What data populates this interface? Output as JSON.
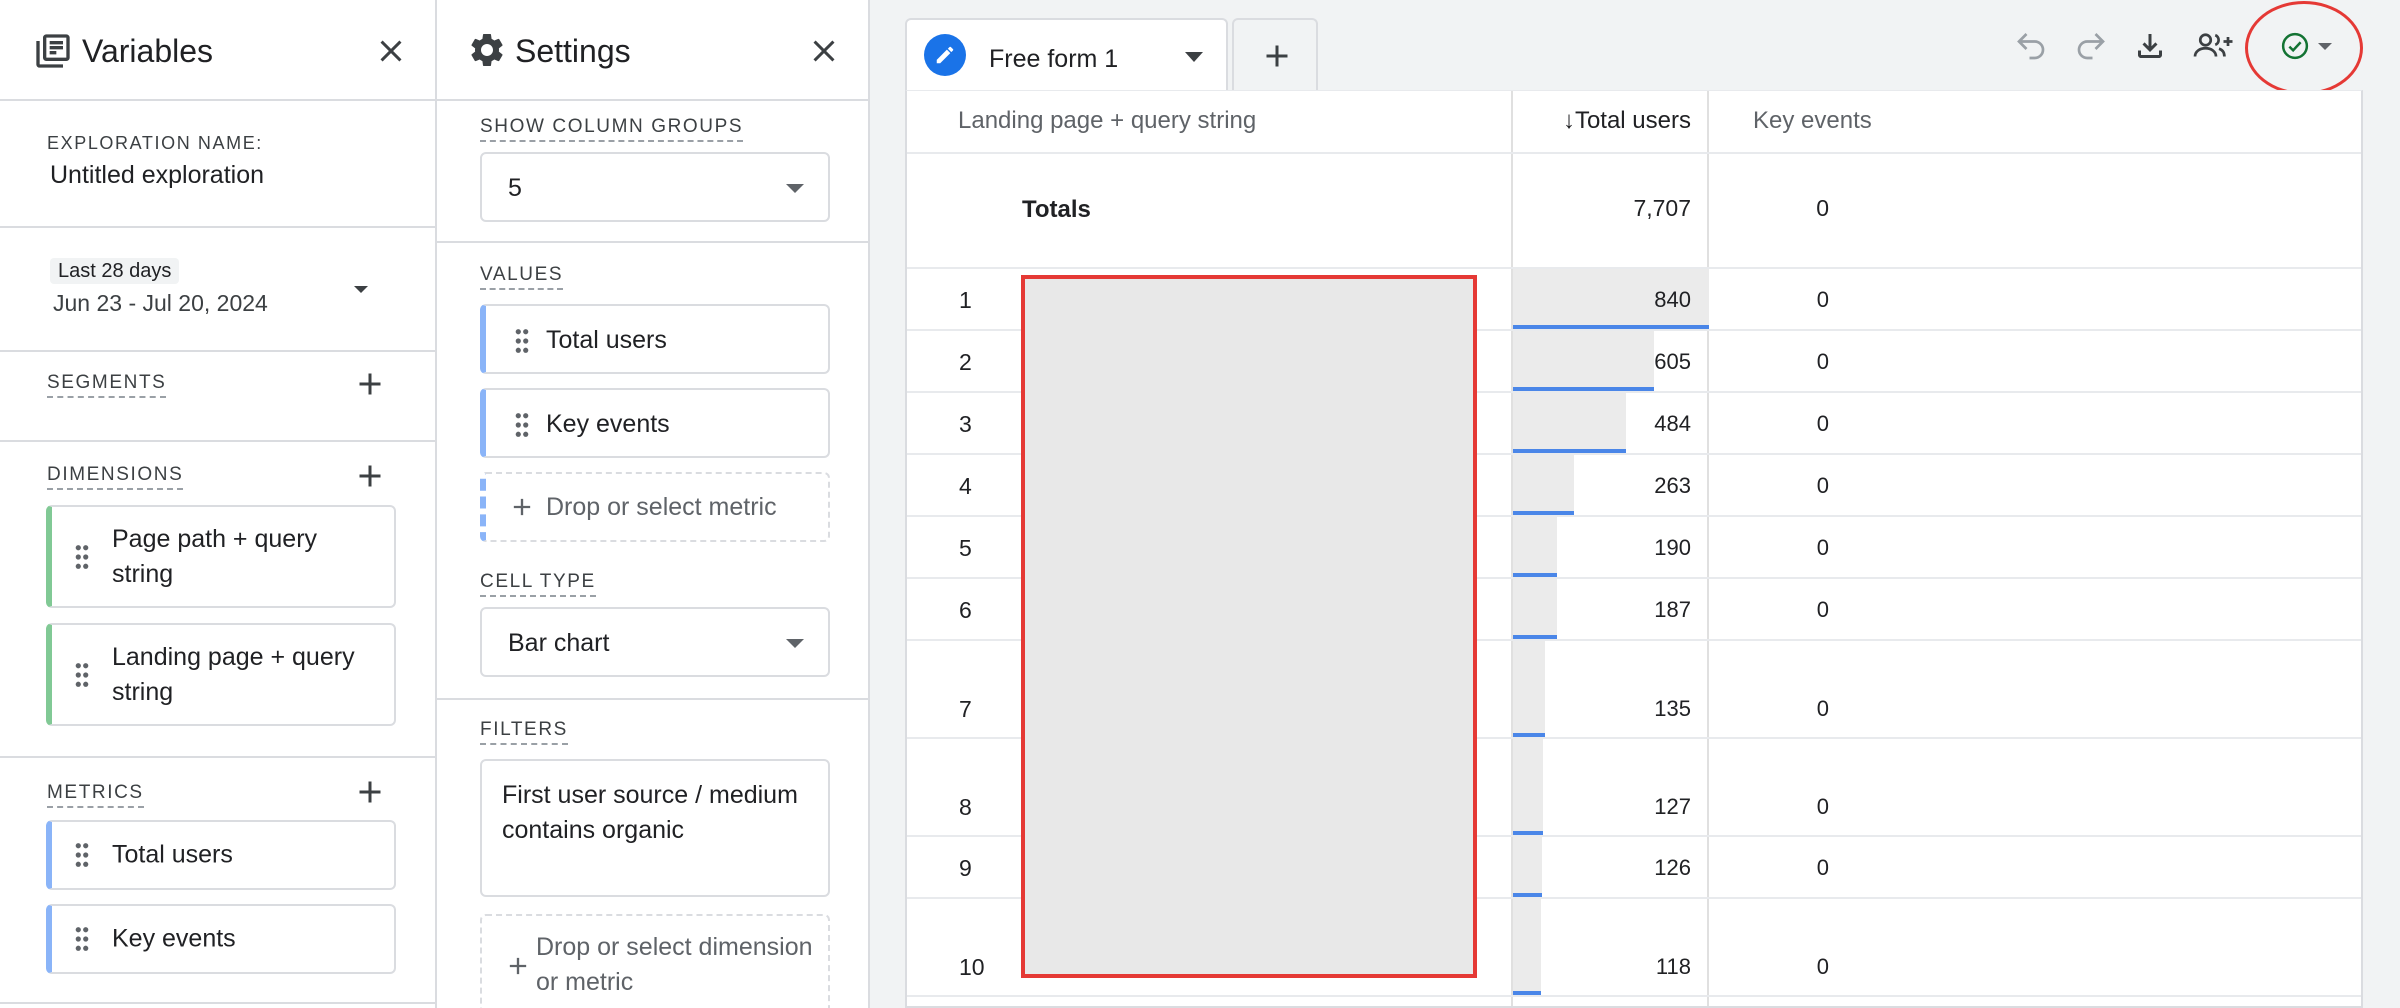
{
  "variables": {
    "title": "Variables",
    "exploration_name_label": "EXPLORATION NAME:",
    "exploration_name": "Untitled exploration",
    "date_range_label": "Last 28 days",
    "date_range_value": "Jun 23 - Jul 20, 2024",
    "segments_label": "SEGMENTS",
    "dimensions_label": "DIMENSIONS",
    "dimensions": [
      "Page path + query string",
      "Landing page + query string"
    ],
    "metrics_label": "METRICS",
    "metrics": [
      "Total users",
      "Key events"
    ]
  },
  "settings": {
    "title": "Settings",
    "show_column_groups_label": "SHOW COLUMN GROUPS",
    "show_column_groups_value": "5",
    "values_label": "VALUES",
    "values": [
      "Total users",
      "Key events"
    ],
    "drop_metric_label": "Drop or select metric",
    "cell_type_label": "CELL TYPE",
    "cell_type_value": "Bar chart",
    "filters_label": "FILTERS",
    "filter_text": "First user source / medium contains organic",
    "drop_filter_label": "Drop or select dimension or metric"
  },
  "canvas": {
    "tab_label": "Free form 1",
    "toolbar_icons": [
      "undo-icon",
      "redo-icon",
      "download-icon",
      "share-users-icon",
      "check-circle-icon"
    ],
    "table": {
      "dimension_header": "Landing page + query string",
      "metric_headers": [
        "Total users",
        "Key events"
      ],
      "sort_arrow": "↓",
      "totals_label": "Totals",
      "totals_users": "7,707",
      "totals_key_events": "0",
      "rows": [
        {
          "index": "1",
          "users": "840",
          "key_events": "0"
        },
        {
          "index": "2",
          "users": "605",
          "key_events": "0"
        },
        {
          "index": "3",
          "users": "484",
          "key_events": "0"
        },
        {
          "index": "4",
          "users": "263",
          "key_events": "0"
        },
        {
          "index": "5",
          "users": "190",
          "key_events": "0"
        },
        {
          "index": "6",
          "users": "187",
          "key_events": "0"
        },
        {
          "index": "7",
          "users": "135",
          "key_events": "0"
        },
        {
          "index": "8",
          "users": "127",
          "key_events": "0"
        },
        {
          "index": "9",
          "users": "126",
          "key_events": "0"
        },
        {
          "index": "10",
          "users": "118",
          "key_events": "0"
        }
      ]
    }
  },
  "colors": {
    "accent_blue": "#1a73e8",
    "bar_blue": "#4a86e8",
    "dimension_green": "#81c995",
    "metric_blue": "#8ab4f8",
    "highlight_red": "#e53935"
  }
}
